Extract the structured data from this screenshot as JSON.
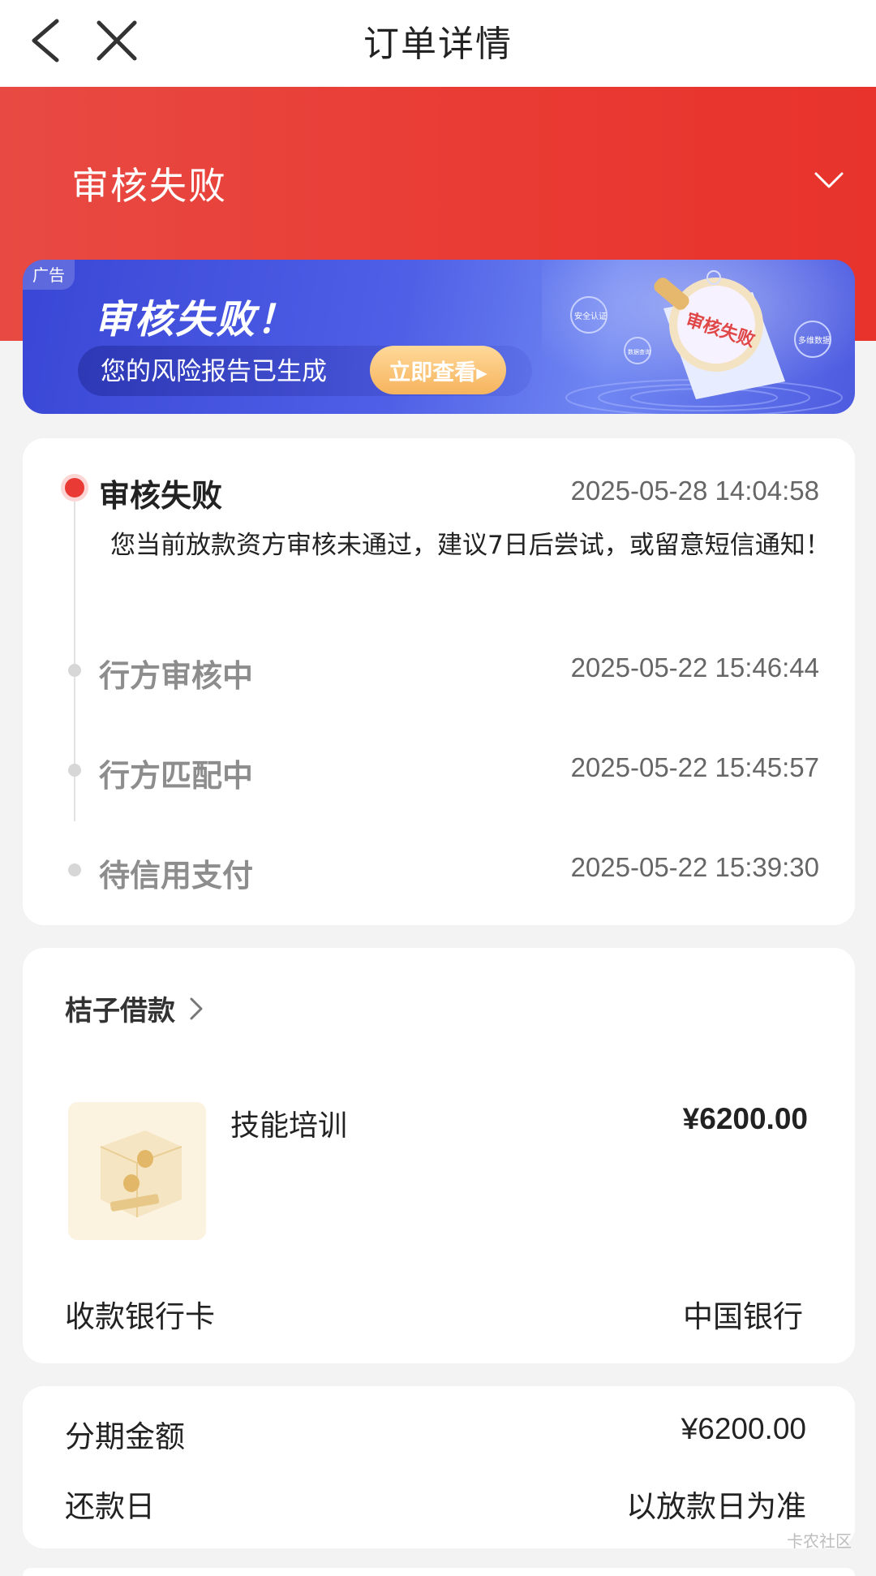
{
  "navbar": {
    "title": "订单详情",
    "back_icon": "back-chevron-icon",
    "close_icon": "close-icon"
  },
  "header": {
    "status_title": "审核失败",
    "toggle_icon": "chevron-down-icon",
    "background_color": "#e93a33"
  },
  "ad_banner": {
    "tag": "广告",
    "headline": "审核失败！",
    "subtitle": "您的风险报告已生成",
    "cta_label": "立即查看▸",
    "art_stamp": "审核失败",
    "art_badges": [
      "安全认证",
      "多维数据",
      "数据查询"
    ],
    "background_color": "#4a57e0"
  },
  "timeline": {
    "steps": [
      {
        "label": "审核失败",
        "time": "2025-05-28 14:04:58",
        "description": "您当前放款资方审核未通过，建议7日后尝试，或留意短信通知！",
        "active": true
      },
      {
        "label": "行方审核中",
        "time": "2025-05-22 15:46:44",
        "active": false
      },
      {
        "label": "行方匹配中",
        "time": "2025-05-22 15:45:57",
        "active": false
      },
      {
        "label": "待信用支付",
        "time": "2025-05-22 15:39:30",
        "active": false
      }
    ]
  },
  "order": {
    "merchant": "桔子借款",
    "product_name": "技能培训",
    "product_price": "¥6200.00",
    "bank_card_label": "收款银行卡",
    "bank_card_value": "中国银行"
  },
  "summary": {
    "amount_label": "分期金额",
    "amount_value": "¥6200.00",
    "repay_label": "还款日",
    "repay_value": "以放款日为准"
  },
  "watermark": "卡农社区"
}
